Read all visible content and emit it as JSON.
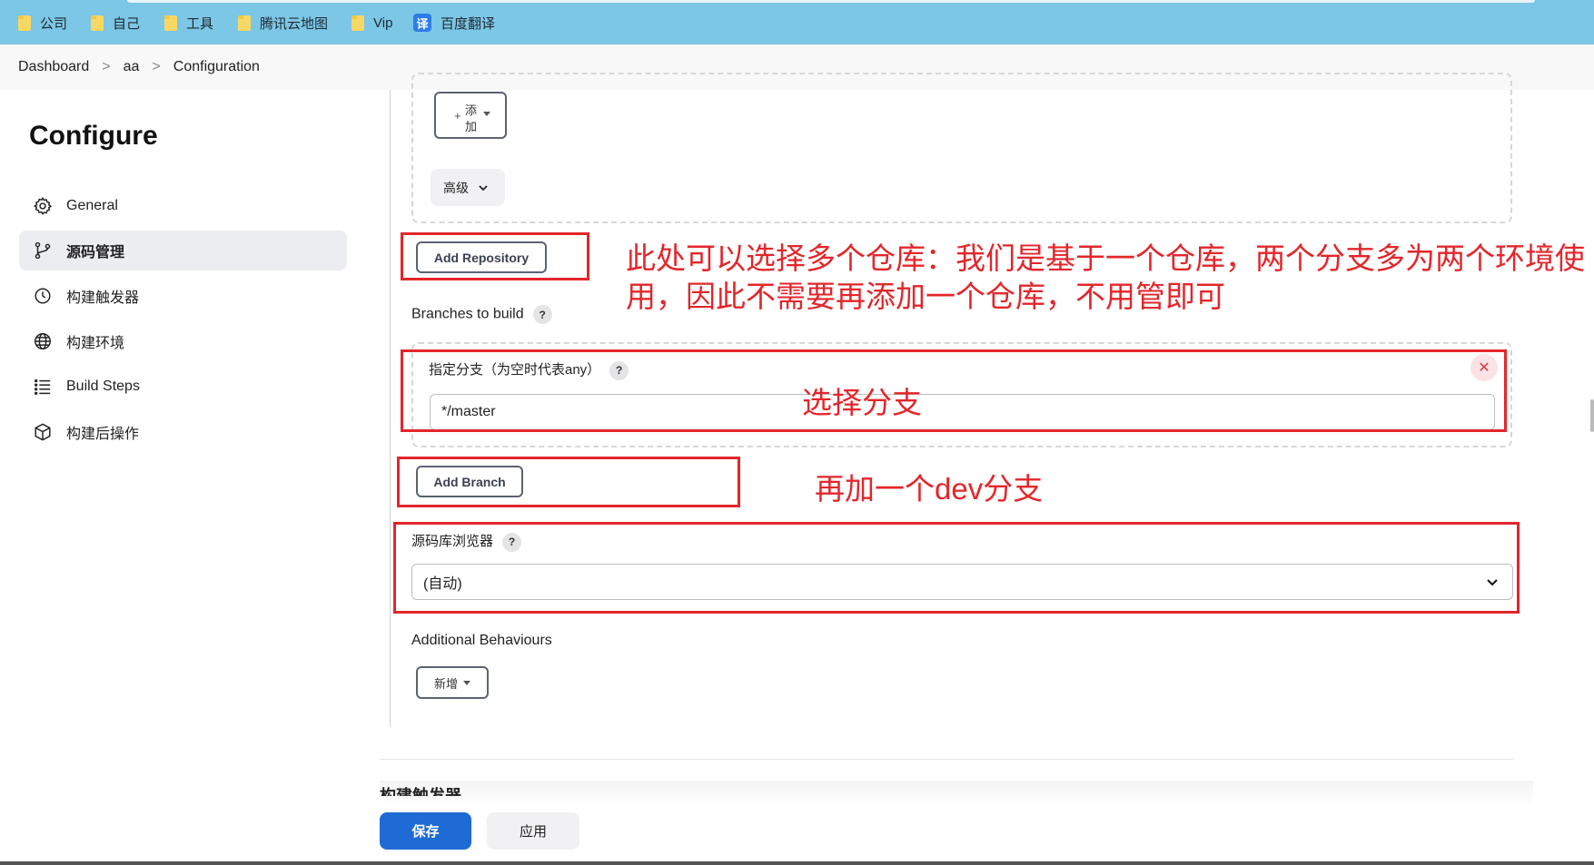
{
  "bookmarks": [
    {
      "label": "公司",
      "icon": "folder-icon"
    },
    {
      "label": "自己",
      "icon": "folder-icon"
    },
    {
      "label": "工具",
      "icon": "folder-icon"
    },
    {
      "label": "腾讯云地图",
      "icon": "folder-icon"
    },
    {
      "label": "Vip",
      "icon": "folder-icon"
    },
    {
      "label": "百度翻译",
      "icon": "translate-icon",
      "icon_glyph": "译"
    }
  ],
  "breadcrumb": {
    "items": [
      "Dashboard",
      "aa",
      "Configuration"
    ],
    "separator": ">"
  },
  "sidebar": {
    "title": "Configure",
    "items": [
      {
        "label": "General",
        "icon": "gear-icon"
      },
      {
        "label": "源码管理",
        "icon": "git-branch-icon",
        "active": true
      },
      {
        "label": "构建触发器",
        "icon": "clock-icon"
      },
      {
        "label": "构建环境",
        "icon": "globe-icon"
      },
      {
        "label": "Build Steps",
        "icon": "list-icon"
      },
      {
        "label": "构建后操作",
        "icon": "cube-icon"
      }
    ]
  },
  "scm": {
    "add_button": {
      "line1": "添",
      "line2": "加"
    },
    "advanced_label": "高级",
    "add_repository_label": "Add Repository",
    "branches_label": "Branches to build",
    "help_glyph": "?",
    "branch_spec_label": "指定分支（为空时代表any）",
    "branch_spec_value": "*/master",
    "close_glyph": "✕",
    "add_branch_label": "Add Branch",
    "repo_browser_label": "源码库浏览器",
    "repo_browser_value": "(自动)",
    "additional_behaviours_label": "Additional Behaviours",
    "new_button_label": "新增"
  },
  "footer": {
    "partial_heading": "构建触发器",
    "save_label": "保存",
    "apply_label": "应用"
  },
  "annotations": {
    "repo_note_line1": "此处可以选择多个仓库：我们是基于一个仓库，两个分支多为两个环境使",
    "repo_note_line2": "用，因此不需要再添加一个仓库，不用管即可",
    "branch_note": "选择分支",
    "add_branch_note": "再加一个dev分支",
    "color": "#e3262b"
  },
  "colors": {
    "bookmark_bar": "#7cc6e6",
    "primary": "#1e6bd6",
    "annotation_red": "#e3262b"
  }
}
